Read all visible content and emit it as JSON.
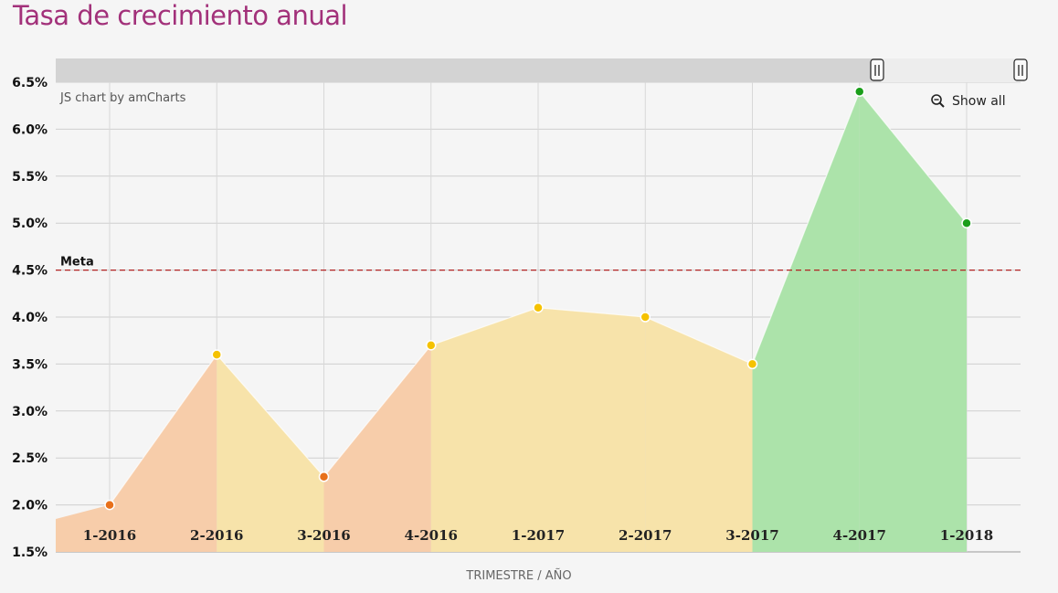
{
  "page": {
    "title": "Tasa de crecimiento anual"
  },
  "chart_data": {
    "type": "area",
    "xlabel": "TRIMESTRE / AÑO",
    "ylabel": "",
    "categories": [
      "1-2016",
      "2-2016",
      "3-2016",
      "4-2016",
      "1-2017",
      "2-2017",
      "3-2017",
      "4-2017",
      "1-2018"
    ],
    "values": [
      2.0,
      3.6,
      2.3,
      3.7,
      4.1,
      4.0,
      3.5,
      6.4,
      5.0
    ],
    "lead_in_value": 1.85,
    "ylim": [
      1.5,
      6.5
    ],
    "ytick_step": 0.5,
    "ytick_format": "{v}%",
    "grid": true,
    "goal_line": {
      "label": "Meta",
      "value": 4.5,
      "color": "#b22222"
    },
    "segment_colors": {
      "low": "#f7cdaa",
      "mid": "#f7e3aa",
      "high": "#ace3aa"
    },
    "point_colors": {
      "low": "#e8701a",
      "mid": "#f5c200",
      "high": "#1a9e1a"
    },
    "segments": [
      "low",
      "mid",
      "low",
      "mid",
      "mid",
      "mid",
      "high",
      "high"
    ],
    "points": [
      "low",
      "mid",
      "low",
      "mid",
      "mid",
      "mid",
      "mid",
      "high",
      "high"
    ],
    "credit": "JS chart by amCharts",
    "show_all_label": "Show all",
    "scrollbar": {
      "range_start": 0.855,
      "range_end": 1.0
    }
  }
}
